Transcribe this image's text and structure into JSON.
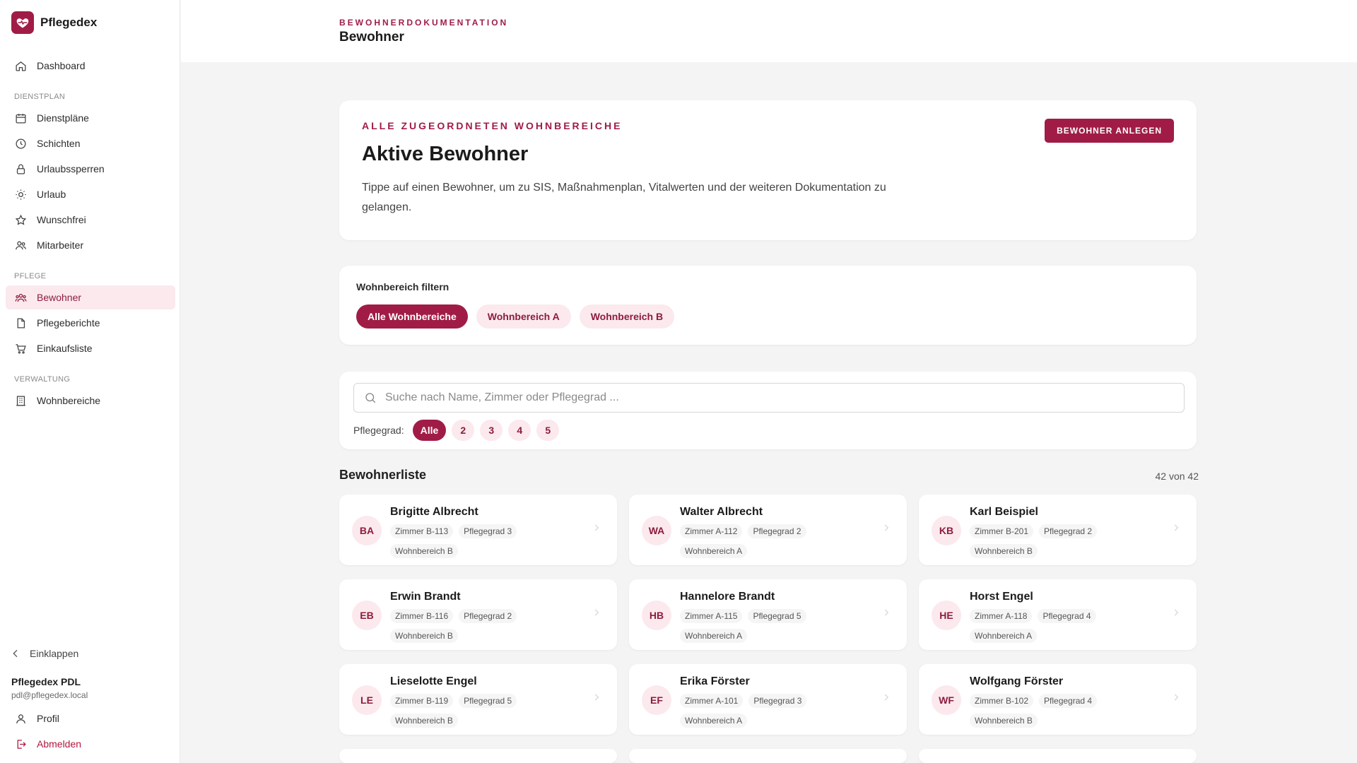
{
  "brand": {
    "name": "Pflegedex"
  },
  "sidebar": {
    "dashboard": "Dashboard",
    "sections": {
      "dienstplan": "DIENSTPLAN",
      "pflege": "PFLEGE",
      "verwaltung": "VERWALTUNG"
    },
    "items": [
      {
        "label": "Dienstpläne",
        "icon": "calendar-icon"
      },
      {
        "label": "Schichten",
        "icon": "clock-icon"
      },
      {
        "label": "Urlaubssperren",
        "icon": "lock-icon"
      },
      {
        "label": "Urlaub",
        "icon": "sun-icon"
      },
      {
        "label": "Wunschfrei",
        "icon": "star-icon"
      },
      {
        "label": "Mitarbeiter",
        "icon": "users-icon"
      },
      {
        "label": "Bewohner",
        "icon": "residents-icon",
        "active": true
      },
      {
        "label": "Pflegeberichte",
        "icon": "document-icon"
      },
      {
        "label": "Einkaufsliste",
        "icon": "cart-icon"
      },
      {
        "label": "Wohnbereiche",
        "icon": "building-icon"
      }
    ],
    "collapse": "Einklappen",
    "user": {
      "name": "Pflegedex PDL",
      "email": "pdl@pflegedex.local"
    },
    "profile": "Profil",
    "logout": "Abmelden"
  },
  "header": {
    "kicker": "BEWOHNERDOKUMENTATION",
    "title": "Bewohner"
  },
  "hero": {
    "kicker": "ALLE ZUGEORDNETEN WOHNBEREICHE",
    "title": "Aktive Bewohner",
    "text": "Tippe auf einen Bewohner, um zu SIS, Maßnahmenplan, Vitalwerten und der weiteren Dokumentation zu gelangen.",
    "button": "BEWOHNER ANLEGEN"
  },
  "filter": {
    "label": "Wohnbereich filtern",
    "options": [
      "Alle Wohnbereiche",
      "Wohnbereich A",
      "Wohnbereich B"
    ],
    "selected": "Alle Wohnbereiche"
  },
  "search": {
    "placeholder": "Suche nach Name, Zimmer oder Pflegegrad ...",
    "value": "",
    "pflegegrad_label": "Pflegegrad:",
    "pflegegrad_options": [
      "Alle",
      "2",
      "3",
      "4",
      "5"
    ],
    "pflegegrad_selected": "Alle"
  },
  "list": {
    "title": "Bewohnerliste",
    "count": "42 von 42",
    "residents": [
      {
        "initials": "BA",
        "name": "Brigitte Albrecht",
        "room": "Zimmer B-113",
        "grade": "Pflegegrad 3",
        "area": "Wohnbereich B"
      },
      {
        "initials": "WA",
        "name": "Walter Albrecht",
        "room": "Zimmer A-112",
        "grade": "Pflegegrad 2",
        "area": "Wohnbereich A"
      },
      {
        "initials": "KB",
        "name": "Karl Beispiel",
        "room": "Zimmer B-201",
        "grade": "Pflegegrad 2",
        "area": "Wohnbereich B"
      },
      {
        "initials": "EB",
        "name": "Erwin Brandt",
        "room": "Zimmer B-116",
        "grade": "Pflegegrad 2",
        "area": "Wohnbereich B"
      },
      {
        "initials": "HB",
        "name": "Hannelore Brandt",
        "room": "Zimmer A-115",
        "grade": "Pflegegrad 5",
        "area": "Wohnbereich A"
      },
      {
        "initials": "HE",
        "name": "Horst Engel",
        "room": "Zimmer A-118",
        "grade": "Pflegegrad 4",
        "area": "Wohnbereich A"
      },
      {
        "initials": "LE",
        "name": "Lieselotte Engel",
        "room": "Zimmer B-119",
        "grade": "Pflegegrad 5",
        "area": "Wohnbereich B"
      },
      {
        "initials": "EF",
        "name": "Erika Förster",
        "room": "Zimmer A-101",
        "grade": "Pflegegrad 3",
        "area": "Wohnbereich A"
      },
      {
        "initials": "WF",
        "name": "Wolfgang Förster",
        "room": "Zimmer B-102",
        "grade": "Pflegegrad 4",
        "area": "Wohnbereich B"
      }
    ]
  },
  "colors": {
    "accent": "#a01c46",
    "accent_soft": "#fbe9ee",
    "background": "#f5f4f4"
  }
}
